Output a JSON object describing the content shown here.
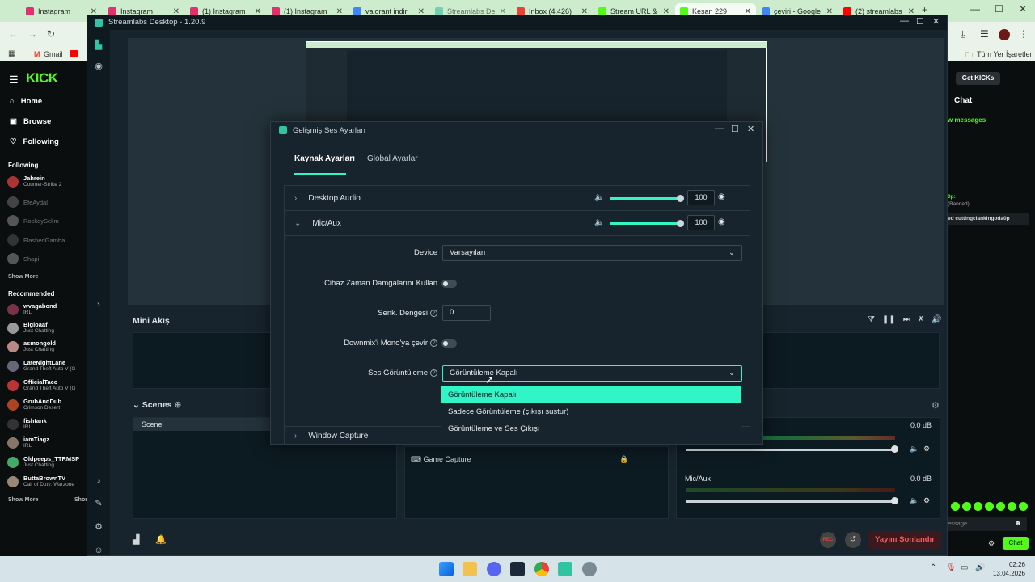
{
  "browser": {
    "tabs": [
      {
        "label": "Instagram",
        "color": "#e1306c"
      },
      {
        "label": "Instagram",
        "color": "#e1306c"
      },
      {
        "label": "(1) Instagram",
        "color": "#e1306c"
      },
      {
        "label": "(1) Instagram",
        "color": "#e1306c"
      },
      {
        "label": "valorant indir",
        "color": "#4285f4"
      },
      {
        "label": "Streamlabs De",
        "color": "#31c3a2"
      },
      {
        "label": "Inbox (4,426)",
        "color": "#ea4335"
      },
      {
        "label": "Stream URL &",
        "color": "#53fc18"
      },
      {
        "label": "Kesan 229",
        "color": "#53fc18"
      },
      {
        "label": "çeviri - Google",
        "color": "#4285f4"
      },
      {
        "label": "(2) streamlabs",
        "color": "#ff0000"
      }
    ],
    "bookmarks": {
      "gmail": "Gmail",
      "all_bookmarks": "Tüm Yer İşaretleri"
    }
  },
  "kick": {
    "logo": "KICK",
    "nav": {
      "home": "Home",
      "browse": "Browse",
      "following": "Following"
    },
    "following_title": "Following",
    "following": [
      {
        "name": "Jahrein",
        "game": "Counter-Strike 2",
        "online": true
      },
      {
        "name": "EfeAydal",
        "game": "",
        "online": false
      },
      {
        "name": "RockeySelim",
        "game": "",
        "online": false
      },
      {
        "name": "FlashedGamba",
        "game": "",
        "online": false
      },
      {
        "name": "Shapi",
        "game": "",
        "online": false
      }
    ],
    "show_more": "Show More",
    "recommended_title": "Recommended",
    "recommended": [
      {
        "name": "wvagabond",
        "game": "IRL"
      },
      {
        "name": "Bigloaaf",
        "game": "Just Chatting"
      },
      {
        "name": "asmongold",
        "game": "Just Chatting"
      },
      {
        "name": "LateNightLane",
        "game": "Grand Theft Auto V (G"
      },
      {
        "name": "OfficialTaco",
        "game": "Grand Theft Auto V (G"
      },
      {
        "name": "GrubAndDub",
        "game": "Crimson Desert"
      },
      {
        "name": "fishtank",
        "game": "IRL"
      },
      {
        "name": "iamTiagz",
        "game": "IRL"
      },
      {
        "name": "Oldpeeps_TTRMSP",
        "game": "Just Chatting"
      },
      {
        "name": "ButtaBrownTV",
        "game": "Call of Duty: Warzone"
      }
    ],
    "show_more_2": "Show More",
    "show_more_3": "Shor"
  },
  "chat": {
    "get_kicks": "Get KICKs",
    "title": "Chat",
    "new_messages": "w messages",
    "msg1": "0p: ",
    "msg1b": "(Banned)",
    "msg2": "ed cuttingclankingoda0p",
    "input_placeholder": "essage",
    "send": "Chat"
  },
  "streamlabs": {
    "title": "Streamlabs Desktop - 1.20.9",
    "mini_title": "Mini Akış",
    "scenes_title": "Scenes",
    "scene_item": "Scene",
    "source_item": "Game Capture",
    "mixer": [
      {
        "name": "",
        "db": "0.0 dB"
      },
      {
        "name": "Mic/Aux",
        "db": "0.0 dB"
      }
    ],
    "end_stream": "Yayını Sonlandır",
    "rec": "REC"
  },
  "dialog": {
    "title": "Gelişmiş Ses Ayarları",
    "tabs": [
      "Kaynak Ayarları",
      "Global Ayarlar"
    ],
    "sources": [
      {
        "name": "Desktop Audio",
        "volume": "100",
        "level": 1.0
      },
      {
        "name": "Mic/Aux",
        "volume": "100",
        "level": 1.0
      }
    ],
    "fields": {
      "device_label": "Device",
      "device_value": "Varsayılan",
      "timestamps_label": "Cihaz Zaman Damgalarını Kullan",
      "sync_label": "Senk. Dengesi",
      "sync_value": "0",
      "downmix_label": "Downmix'i Mono'ya çevir",
      "monitor_label": "Ses Görüntüleme",
      "monitor_value": "Görüntüleme Kapalı"
    },
    "monitor_options": [
      "Görüntüleme Kapalı",
      "Sadece Görüntüleme (çıkışı sustur)",
      "Görüntüleme ve Ses Çıkışı"
    ],
    "next_source": "Window Capture"
  },
  "taskbar": {
    "time": "02:26",
    "date": "13.04.2026"
  },
  "colors": {
    "accent": "#31f5c6",
    "kick_green": "#53fc18",
    "danger": "#e04040"
  }
}
